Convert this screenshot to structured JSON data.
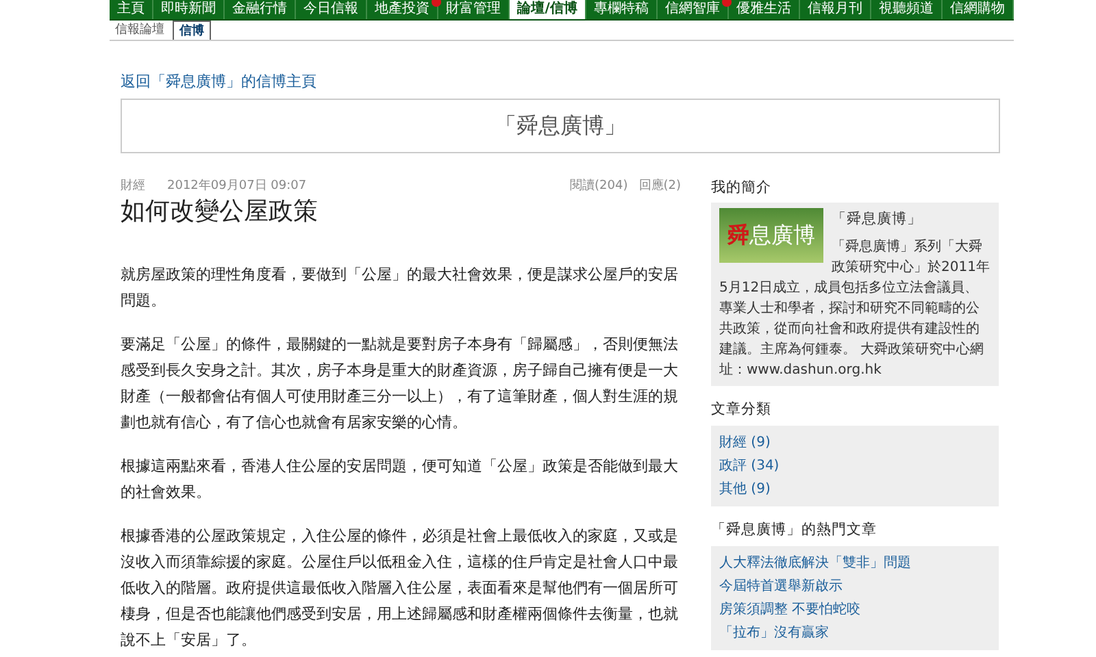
{
  "nav": {
    "tabs": [
      {
        "label": "主頁",
        "selected": false,
        "new_badge": false
      },
      {
        "label": "即時新聞",
        "selected": false,
        "new_badge": false
      },
      {
        "label": "金融行情",
        "selected": false,
        "new_badge": false
      },
      {
        "label": "今日信報",
        "selected": false,
        "new_badge": false
      },
      {
        "label": "地產投資",
        "selected": false,
        "new_badge": true
      },
      {
        "label": "財富管理",
        "selected": false,
        "new_badge": false
      },
      {
        "label": "論壇/信博",
        "selected": true,
        "new_badge": false
      },
      {
        "label": "專欄特稿",
        "selected": false,
        "new_badge": false
      },
      {
        "label": "信網智庫",
        "selected": false,
        "new_badge": true
      },
      {
        "label": "優雅生活",
        "selected": false,
        "new_badge": false
      },
      {
        "label": "信報月刊",
        "selected": false,
        "new_badge": false
      },
      {
        "label": "視聽頻道",
        "selected": false,
        "new_badge": false
      },
      {
        "label": "信網購物",
        "selected": false,
        "new_badge": false
      }
    ],
    "subtabs": [
      {
        "label": "信報論壇",
        "selected": false
      },
      {
        "label": "信博",
        "selected": true
      }
    ]
  },
  "back_link": "返回「舜息廣博」的信博主頁",
  "blog_title": "「舜息廣博」",
  "article": {
    "category": "財經",
    "date": "2012年09月07日 09:07",
    "views": "閱讀(204)",
    "replies": "回應(2)",
    "title": "如何改變公屋政策",
    "paragraphs": [
      "就房屋政策的理性角度看，要做到「公屋」的最大社會效果，便是謀求公屋戶的安居問題。",
      "要滿足「公屋」的條件，最關鍵的一點就是要對房子本身有「歸屬感」，否則便無法感受到長久安身之計。其次，房子本身是重大的財產資源，房子歸自己擁有便是一大財產（一般都會佔有個人可使用財產三分一以上），有了這筆財產，個人對生涯的規劃也就有信心，有了信心也就會有居家安樂的心情。",
      "根據這兩點來看，香港人住公屋的安居問題，便可知道「公屋」政策是否能做到最大的社會效果。",
      "根據香港的公屋政策規定，入住公屋的條件，必須是社會上最低收入的家庭，又或是沒收入而須靠綜援的家庭。公屋住戶以低租金入住，這樣的住戶肯定是社會人口中最低收入的階層。政府提供這最低收入階層入住公屋，表面看來是幫他們有一個居所可棲身，但是否也能讓他們感受到安居，用上述歸屬感和財產權兩個條件去衡量，也就說不上「安居」了。"
    ]
  },
  "sidebar": {
    "profile": {
      "heading": "我的簡介",
      "logo_accent": "舜",
      "logo_rest": "息廣博",
      "name": "「舜息廣博」",
      "description": "「舜息廣博」系列「大舜政策研究中心」於2011年5月12日成立，成員包括多位立法會議員、專業人士和學者，探討和研究不同範疇的公共政策，從而向社會和政府提供有建設性的建議。主席為何鍾泰。 大舜政策研究中心網址：www.dashun.org.hk"
    },
    "categories": {
      "heading": "文章分類",
      "items": [
        "財經 (9)",
        "政評 (34)",
        "其他 (9)"
      ]
    },
    "popular": {
      "heading": "「舜息廣博」的熱門文章",
      "items": [
        "人大釋法徹底解決「雙非」問題",
        "今屆特首選舉新啟示",
        "房策須調整 不要怕蛇咬",
        "「拉布」沒有贏家"
      ]
    }
  }
}
